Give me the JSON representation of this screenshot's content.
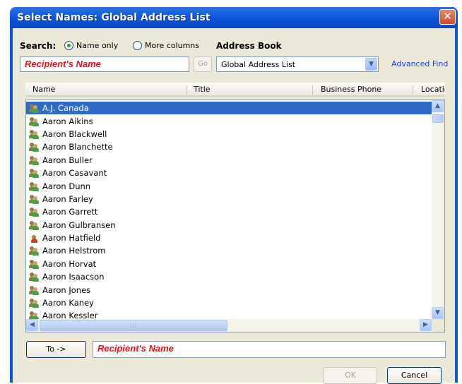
{
  "window": {
    "title": "Select Names: Global Address List",
    "close_glyph": "✕"
  },
  "search": {
    "label": "Search:",
    "option_name_only": "Name only",
    "option_more_columns": "More columns",
    "selected_option": "Name only",
    "input_value": "Recipient's Name",
    "go_label": "Go"
  },
  "address_book": {
    "label": "Address Book",
    "selected": "Global Address List",
    "advanced_find": "Advanced Find"
  },
  "columns": [
    "Name",
    "Title",
    "Business Phone",
    "Locatic"
  ],
  "contacts": [
    {
      "name": "A.J. Canada",
      "icon": "user-group-icon",
      "selected": true
    },
    {
      "name": "Aaron Aikins",
      "icon": "user-group-icon"
    },
    {
      "name": "Aaron Blackwell",
      "icon": "user-group-icon"
    },
    {
      "name": "Aaron Blanchette",
      "icon": "user-group-icon"
    },
    {
      "name": "Aaron Buller",
      "icon": "user-group-icon"
    },
    {
      "name": "Aaron Casavant",
      "icon": "user-group-icon"
    },
    {
      "name": "Aaron Dunn",
      "icon": "user-group-icon"
    },
    {
      "name": "Aaron Farley",
      "icon": "user-group-icon"
    },
    {
      "name": "Aaron Garrett",
      "icon": "user-group-icon"
    },
    {
      "name": "Aaron Gulbransen",
      "icon": "user-group-icon"
    },
    {
      "name": "Aaron Hatfield",
      "icon": "user-icon"
    },
    {
      "name": "Aaron Helstrom",
      "icon": "user-group-icon"
    },
    {
      "name": "Aaron Horvat",
      "icon": "user-group-icon"
    },
    {
      "name": "Aaron Isaacson",
      "icon": "user-group-icon"
    },
    {
      "name": "Aaron Jones",
      "icon": "user-group-icon"
    },
    {
      "name": "Aaron Kaney",
      "icon": "user-group-icon"
    },
    {
      "name": "Aaron Kessler",
      "icon": "user-group-icon"
    }
  ],
  "recipients": {
    "to_button": "To ->",
    "to_value": "Recipient's Name"
  },
  "buttons": {
    "ok": "OK",
    "cancel": "Cancel"
  },
  "colors": {
    "title_blue": "#0a58d8",
    "selection_blue": "#316ac5",
    "highlight_red": "#e8141d",
    "link_blue": "#1b3bd1"
  }
}
